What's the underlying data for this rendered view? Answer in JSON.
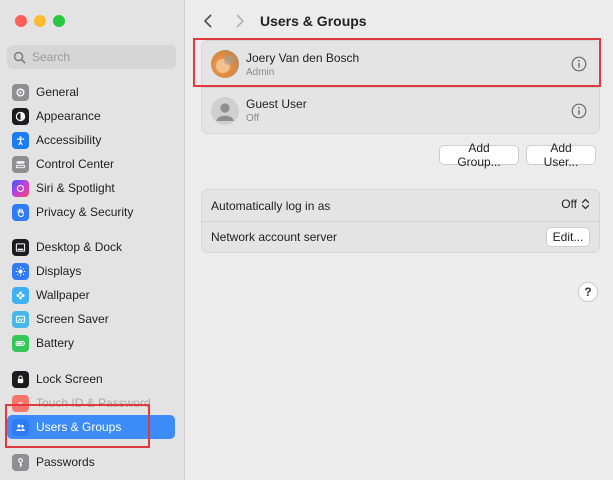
{
  "window": {
    "title": "Users & Groups"
  },
  "sidebar": {
    "search_placeholder": "Search",
    "items": [
      {
        "label": "General",
        "icon": "gear-icon",
        "color": "#8e8e93"
      },
      {
        "label": "Appearance",
        "icon": "appearance-icon",
        "color": "#1c1c1e"
      },
      {
        "label": "Accessibility",
        "icon": "accessibility-icon",
        "color": "#1a7cf2"
      },
      {
        "label": "Control Center",
        "icon": "control-center-icon",
        "color": "#8e8e93"
      },
      {
        "label": "Siri & Spotlight",
        "icon": "siri-icon",
        "color": "#c23ed9"
      },
      {
        "label": "Privacy & Security",
        "icon": "hand-icon",
        "color": "#2f7cf6"
      },
      {
        "label": "Desktop & Dock",
        "icon": "dock-icon",
        "color": "#1c1c1e"
      },
      {
        "label": "Displays",
        "icon": "sun-icon",
        "color": "#2f7cf6"
      },
      {
        "label": "Wallpaper",
        "icon": "flower-icon",
        "color": "#3fb1f2"
      },
      {
        "label": "Screen Saver",
        "icon": "screen-saver-icon",
        "color": "#46b7e6"
      },
      {
        "label": "Battery",
        "icon": "battery-icon",
        "color": "#35c759"
      },
      {
        "label": "Lock Screen",
        "icon": "lock-icon",
        "color": "#1c1c1e"
      },
      {
        "label": "Touch ID & Password",
        "icon": "fingerprint-icon",
        "color": "#ff3b30"
      },
      {
        "label": "Users & Groups",
        "icon": "users-icon",
        "color": "#2f7cf6"
      },
      {
        "label": "Passwords",
        "icon": "key-icon",
        "color": "#8e8e93"
      }
    ],
    "selected_color": "#3d8bf7"
  },
  "users": [
    {
      "name": "Joery Van den Bosch",
      "role": "Admin"
    },
    {
      "name": "Guest User",
      "role": "Off"
    }
  ],
  "buttons": {
    "add_group": "Add Group...",
    "add_user": "Add User..."
  },
  "settings": {
    "auto_login_label": "Automatically log in as",
    "auto_login_value": "Off",
    "network_label": "Network account server",
    "network_button": "Edit..."
  },
  "help_label": "?",
  "highlight_color": "#e0393e"
}
